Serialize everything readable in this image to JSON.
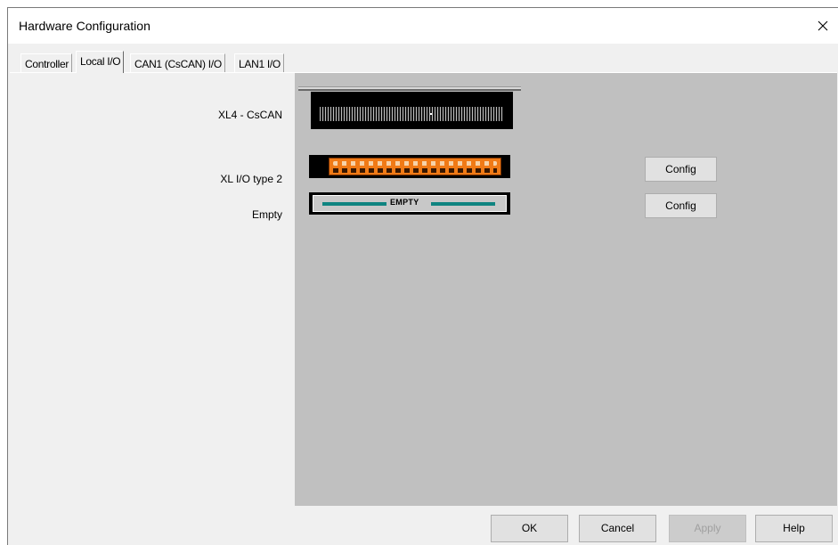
{
  "window": {
    "title": "Hardware Configuration",
    "close_icon": "close-icon"
  },
  "tabs": [
    {
      "label": "Controller",
      "active": false
    },
    {
      "label": "Local I/O",
      "active": true
    },
    {
      "label": "CAN1 (CsCAN) I/O",
      "active": false
    },
    {
      "label": "LAN1 I/O",
      "active": false
    }
  ],
  "slots": [
    {
      "label": "XL4 - CsCAN",
      "module": "controller"
    },
    {
      "label": "XL I/O type 2",
      "module": "io",
      "config_label": "Config"
    },
    {
      "label": "Empty",
      "module": "empty",
      "module_text": "EMPTY",
      "config_label": "Config"
    }
  ],
  "buttons": {
    "ok": "OK",
    "cancel": "Cancel",
    "apply": "Apply",
    "help": "Help"
  },
  "colors": {
    "rack_background": "#c0c0c0",
    "io_terminal": "#f07a16",
    "empty_bar": "#0f8480"
  }
}
